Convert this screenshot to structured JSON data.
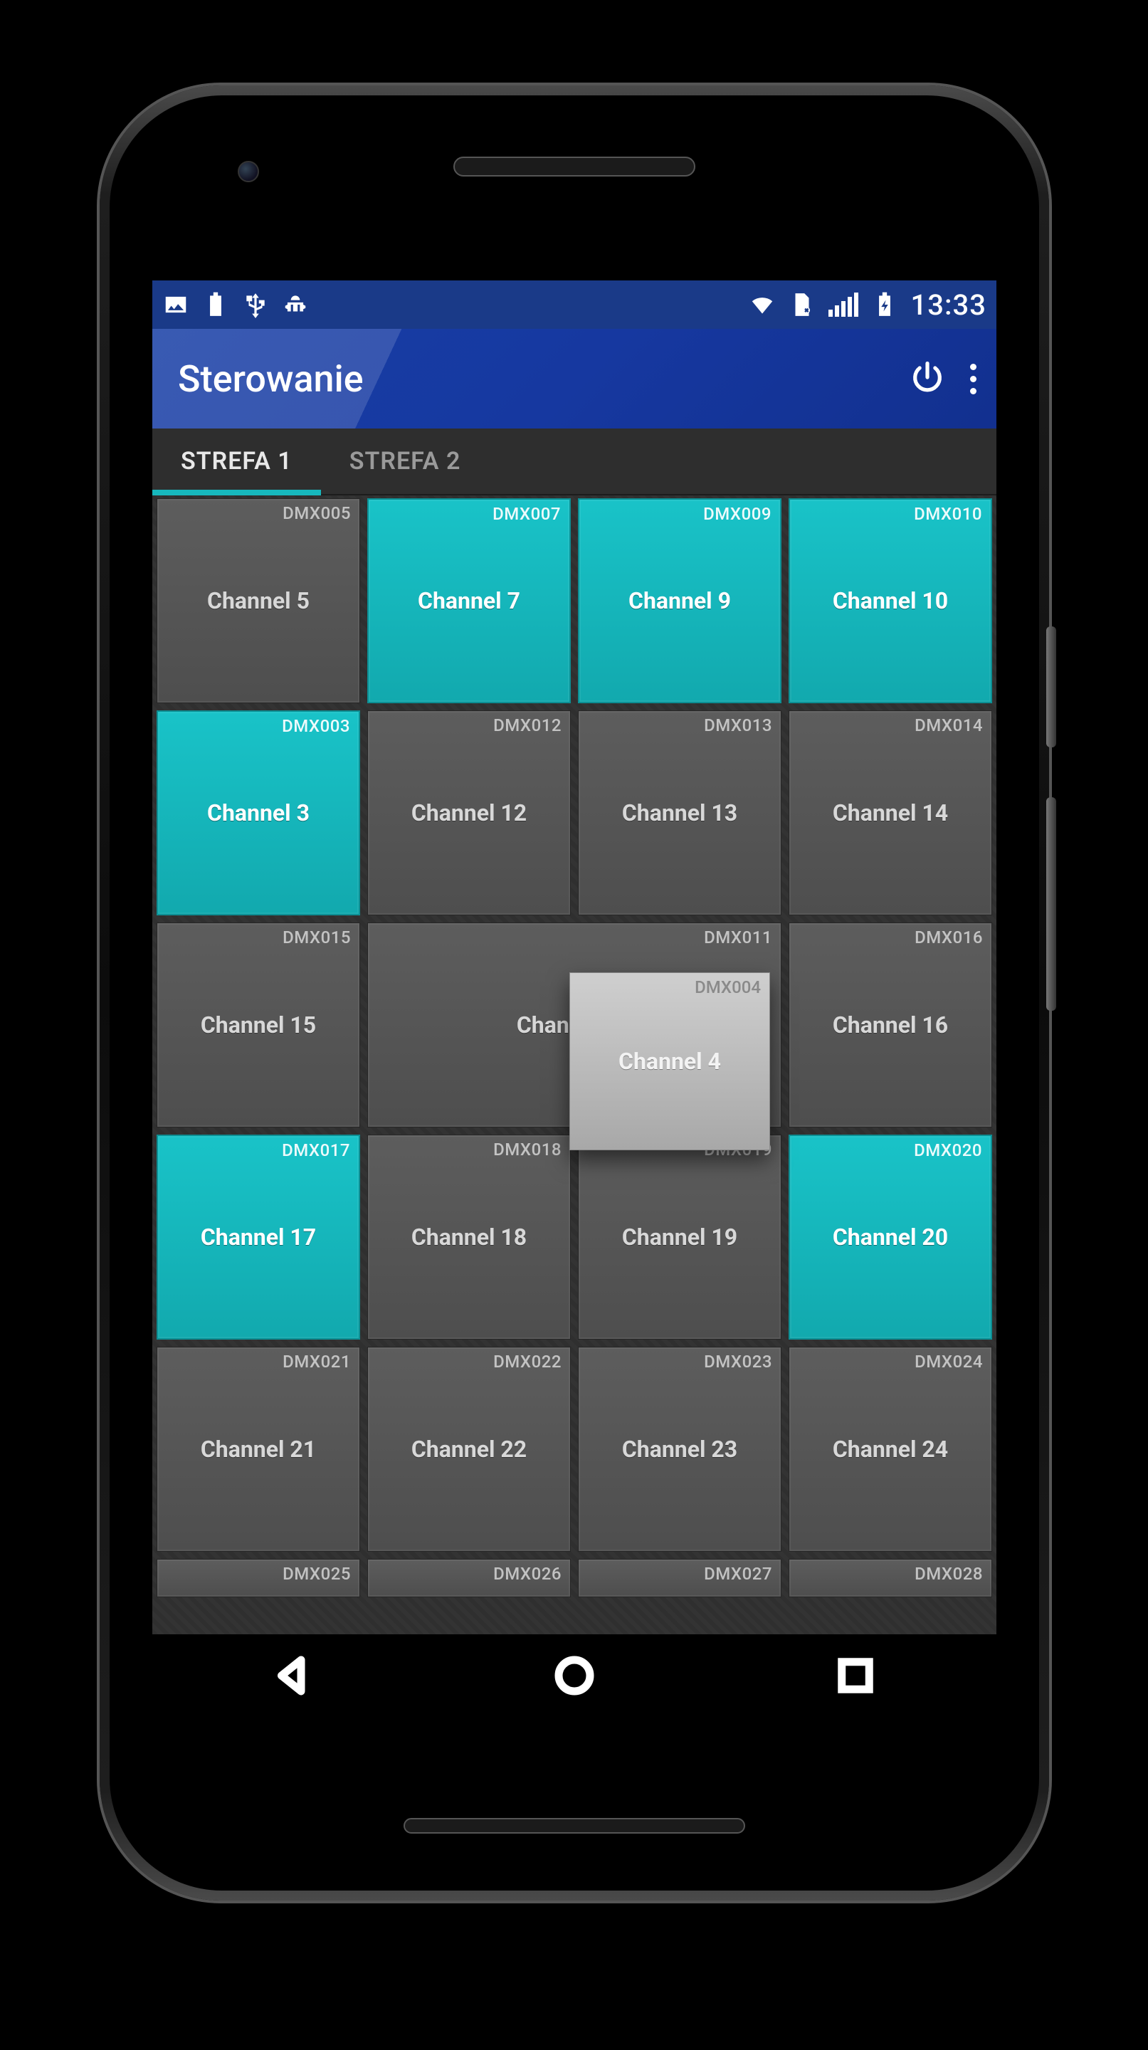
{
  "status": {
    "time": "13:33"
  },
  "actionbar": {
    "title": "Sterowanie"
  },
  "tabs": {
    "items": [
      {
        "label": "STREFA 1",
        "active": true
      },
      {
        "label": "STREFA 2",
        "active": false
      }
    ]
  },
  "colors": {
    "accent_on": "#17b8bd",
    "actionbar": "#1638a0"
  },
  "channels": {
    "rows": [
      [
        {
          "dmx": "DMX005",
          "name": "Channel 5",
          "on": false
        },
        {
          "dmx": "DMX007",
          "name": "Channel 7",
          "on": true
        },
        {
          "dmx": "DMX009",
          "name": "Channel 9",
          "on": true
        },
        {
          "dmx": "DMX010",
          "name": "Channel 10",
          "on": true
        }
      ],
      [
        {
          "dmx": "DMX003",
          "name": "Channel 3",
          "on": true
        },
        {
          "dmx": "DMX012",
          "name": "Channel 12",
          "on": false
        },
        {
          "dmx": "DMX013",
          "name": "Channel 13",
          "on": false
        },
        {
          "dmx": "DMX014",
          "name": "Channel 14",
          "on": false
        }
      ],
      [
        {
          "dmx": "DMX015",
          "name": "Channel 15",
          "on": false
        },
        {
          "dmx": "DMX011",
          "name": "Channel 11",
          "on": false,
          "wide": true
        },
        {
          "dmx": "DMX016",
          "name": "Channel 16",
          "on": false
        }
      ],
      [
        {
          "dmx": "DMX017",
          "name": "Channel 17",
          "on": true
        },
        {
          "dmx": "DMX018",
          "name": "Channel 18",
          "on": false
        },
        {
          "dmx": "DMX019",
          "name": "Channel 19",
          "on": false
        },
        {
          "dmx": "DMX020",
          "name": "Channel 20",
          "on": true
        }
      ],
      [
        {
          "dmx": "DMX021",
          "name": "Channel 21",
          "on": false
        },
        {
          "dmx": "DMX022",
          "name": "Channel 22",
          "on": false
        },
        {
          "dmx": "DMX023",
          "name": "Channel 23",
          "on": false
        },
        {
          "dmx": "DMX024",
          "name": "Channel 24",
          "on": false
        }
      ],
      [
        {
          "dmx": "DMX025",
          "name": "",
          "on": false,
          "peek": true
        },
        {
          "dmx": "DMX026",
          "name": "",
          "on": false,
          "peek": true
        },
        {
          "dmx": "DMX027",
          "name": "",
          "on": false,
          "peek": true
        },
        {
          "dmx": "DMX028",
          "name": "",
          "on": false,
          "peek": true
        }
      ]
    ]
  },
  "dragging": {
    "dmx": "DMX004",
    "name": "Channel 4"
  }
}
